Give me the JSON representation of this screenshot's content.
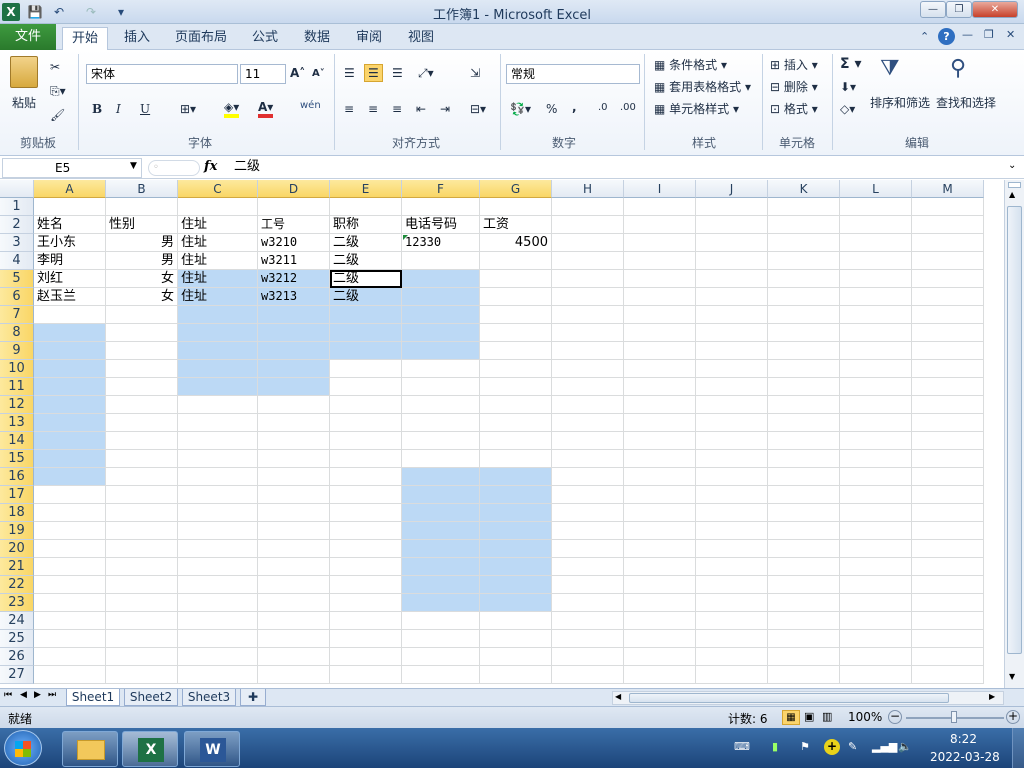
{
  "window": {
    "title": "工作簿1 - Microsoft Excel",
    "quick_access": {
      "save": "💾",
      "undo": "↶",
      "redo": "↷",
      "customize": "▾"
    },
    "controls": {
      "minimize": "—",
      "restore": "❐",
      "close": "✕"
    }
  },
  "ribbon_tabs": [
    "文件",
    "开始",
    "插入",
    "页面布局",
    "公式",
    "数据",
    "审阅",
    "视图"
  ],
  "ribbon": {
    "clipboard": {
      "paste": "粘贴",
      "label": "剪贴板"
    },
    "font": {
      "name": "宋体",
      "size": "11",
      "grow": "A˄",
      "shrink": "A˅",
      "bold": "B",
      "italic": "I",
      "underline": "U",
      "phonetic": "wén",
      "label": "字体"
    },
    "alignment": {
      "label": "对齐方式"
    },
    "number": {
      "format": "常规",
      "percent": "%",
      "comma": ",",
      "inc_decimal": ".0",
      "dec_decimal": ".00",
      "label": "数字"
    },
    "styles": {
      "conditional": "条件格式",
      "table": "套用表格格式",
      "cell_styles": "单元格样式",
      "label": "样式"
    },
    "cells": {
      "insert": "插入",
      "delete": "删除",
      "format": "格式",
      "label": "单元格"
    },
    "editing": {
      "sum": "Σ",
      "sort_filter": "排序和筛选",
      "find_select": "查找和选择",
      "label": "编辑"
    }
  },
  "formula_bar": {
    "name_box": "E5",
    "fx": "fx",
    "content": "二级"
  },
  "columns": [
    "A",
    "B",
    "C",
    "D",
    "E",
    "F",
    "G",
    "H",
    "I",
    "J",
    "K",
    "L",
    "M"
  ],
  "rows": [
    "1",
    "2",
    "3",
    "4",
    "5",
    "6",
    "7",
    "8",
    "9",
    "10",
    "11",
    "12",
    "13",
    "14",
    "15",
    "16",
    "17",
    "18",
    "19",
    "20",
    "21",
    "22",
    "23",
    "24",
    "25",
    "26",
    "27"
  ],
  "cells": {
    "A2": "姓名",
    "B2": "性别",
    "C2": "住址",
    "D2": "工号",
    "E2": "职称",
    "F2": "电话号码",
    "G2": "工资",
    "A3": "王小东",
    "B3": "男",
    "C3": "住址",
    "D3": "w3210",
    "E3": "二级",
    "F3": "12330",
    "G3": "4500",
    "A4": "李明",
    "B4": "男",
    "C4": "住址",
    "D4": "w3211",
    "E4": "二级",
    "A5": "刘红",
    "B5": "女",
    "C5": "住址",
    "D5": "w3212",
    "E5": "二级",
    "A6": "赵玉兰",
    "B6": "女",
    "C6": "住址",
    "D6": "w3213",
    "E6": "二级"
  },
  "active_cell": "E5",
  "sheets": [
    "Sheet1",
    "Sheet2",
    "Sheet3"
  ],
  "status": {
    "ready": "就绪",
    "count": "计数: 6",
    "zoom": "100%"
  },
  "taskbar": {
    "time": "8:22",
    "date": "2022-03-28"
  },
  "colors": {
    "selection": "#bcd9f5",
    "header_selected": "#f9d666",
    "file_tab": "#2a7a2c"
  }
}
